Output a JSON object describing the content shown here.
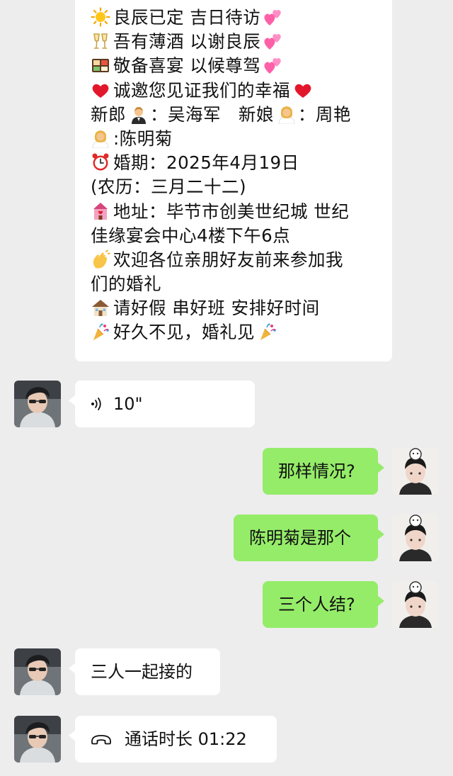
{
  "invitation": {
    "lines": [
      {
        "icon": "sun-icon",
        "text": "良辰已定 吉日待访",
        "trail_icon": "hearts-icon"
      },
      {
        "icon": "champagne-icon",
        "text": "吾有薄酒 以谢良辰",
        "trail_icon": "hearts-icon"
      },
      {
        "icon": "bento-icon",
        "text": "敬备喜宴 以候尊驾",
        "trail_icon": "hearts-icon"
      },
      {
        "icon": "red-heart-icon",
        "text": "诚邀您见证我们的幸福",
        "trail_icon": "red-heart-icon"
      }
    ],
    "groom_label": "新郎",
    "groom_name": "：吴海军",
    "bride_label": "新娘",
    "bride_name": "：周艳",
    "bride2_name": ":陈明菊",
    "date_line": "婚期：2025年4月19日",
    "lunar_line": "(农历：三月二十二)",
    "address_line_1": "地址：毕节市创美世纪城 世纪",
    "address_line_2": "佳缘宴会中心4楼下午6点",
    "welcome_line_1": "欢迎各位亲朋好友前来参加我",
    "welcome_line_2": "们的婚礼",
    "request_line": "请好假 串好班 安排好时间",
    "closing_line": "好久不见，婚礼见"
  },
  "voice_message": {
    "duration": "10\""
  },
  "sent_messages": [
    "那样情况?",
    "陈明菊是那个",
    "三个人结?"
  ],
  "reply_message": "三人一起接的",
  "call_record": {
    "label": "通话时长 01:22"
  },
  "colors": {
    "background": "#ededed",
    "incoming_bubble": "#ffffff",
    "outgoing_bubble": "#95ec69"
  }
}
